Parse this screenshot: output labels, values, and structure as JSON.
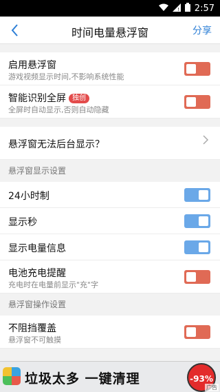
{
  "status_bar": {
    "time": "2:57"
  },
  "app_bar": {
    "title": "时间电量悬浮窗",
    "share_label": "分享"
  },
  "settings": {
    "enable_float": {
      "label": "启用悬浮窗",
      "sub": "游戏视频显示时间,不影响系统性能",
      "state": "off"
    },
    "smart_fullscreen": {
      "label": "智能识别全屏",
      "badge": "独创",
      "sub": "全屏时自动显示,否则自动隐藏",
      "state": "off"
    },
    "cannot_background": {
      "label": "悬浮窗无法后台显示？"
    }
  },
  "display_section": {
    "header": "悬浮窗显示设置",
    "items": [
      {
        "label": "24小时制",
        "state": "on"
      },
      {
        "label": "显示秒",
        "state": "on"
      },
      {
        "label": "显示电量信息",
        "state": "on"
      }
    ],
    "charge": {
      "label": "电池充电提醒",
      "sub": "充电时在电量前显示\"充\"字",
      "state": "off"
    }
  },
  "operation_section": {
    "header": "悬浮窗操作设置",
    "no_block": {
      "label": "不阻挡覆盖",
      "sub": "悬浮窗不可触摸",
      "state": "off"
    }
  },
  "ad": {
    "text": "垃圾太多 一键清理",
    "percent": "-93%",
    "tag": "广告"
  },
  "colors": {
    "accent": "#2d7fd6",
    "toggle_on": "#6aa8e8",
    "toggle_off": "#e06a55",
    "badge": "#e34b4b"
  }
}
